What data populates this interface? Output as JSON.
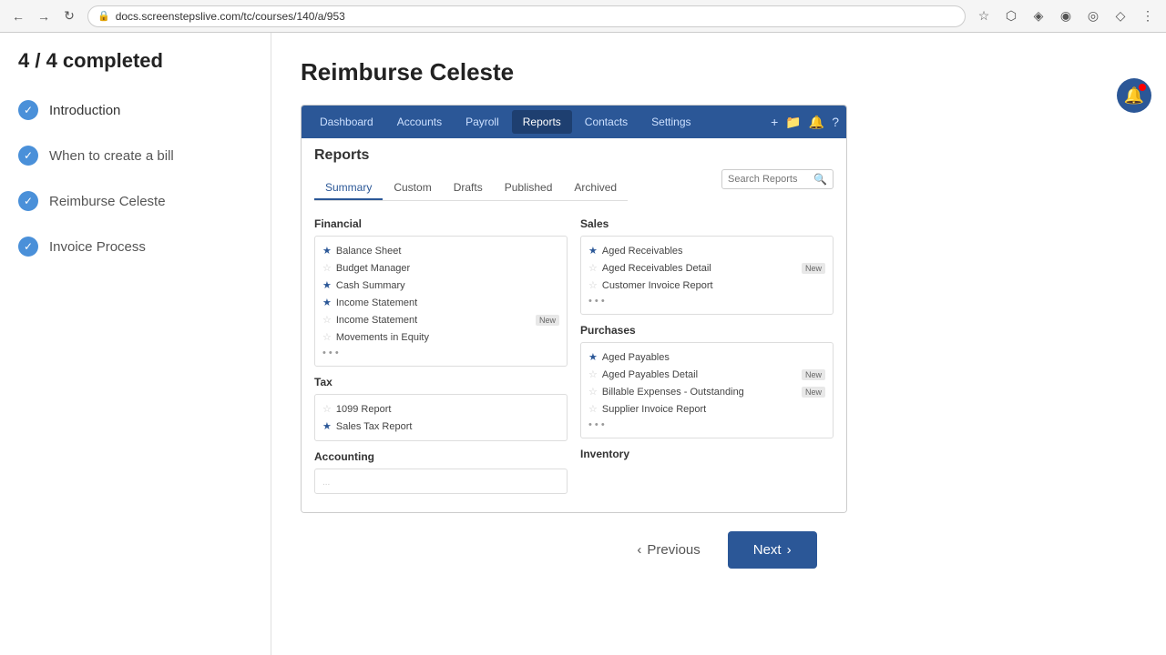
{
  "browser": {
    "url": "docs.screenstepslive.com/tc/courses/140/a/953",
    "back_title": "Back",
    "forward_title": "Forward",
    "refresh_title": "Refresh"
  },
  "progress": {
    "label": "4 / 4 completed"
  },
  "sidebar": {
    "items": [
      {
        "id": "introduction",
        "label": "Introduction",
        "completed": true
      },
      {
        "id": "when-to-create-a-bill",
        "label": "When to create a bill",
        "completed": true
      },
      {
        "id": "reimburse-celeste",
        "label": "Reimburse Celeste",
        "completed": true
      },
      {
        "id": "invoice-process",
        "label": "Invoice Process",
        "completed": true
      }
    ]
  },
  "main": {
    "title": "Reimburse Celeste",
    "app": {
      "nav_items": [
        {
          "label": "Dashboard",
          "active": false
        },
        {
          "label": "Accounts",
          "active": false
        },
        {
          "label": "Payroll",
          "active": false
        },
        {
          "label": "Reports",
          "active": true
        },
        {
          "label": "Contacts",
          "active": false
        },
        {
          "label": "Settings",
          "active": false
        }
      ],
      "reports_title": "Reports",
      "tabs": [
        {
          "label": "Summary",
          "active": true
        },
        {
          "label": "Custom",
          "active": false
        },
        {
          "label": "Drafts",
          "active": false
        },
        {
          "label": "Published",
          "active": false
        },
        {
          "label": "Archived",
          "active": false
        }
      ],
      "search_placeholder": "Search Reports",
      "financial": {
        "title": "Financial",
        "items": [
          {
            "label": "Balance Sheet",
            "starred": true
          },
          {
            "label": "Budget Manager",
            "starred": false
          },
          {
            "label": "Cash Summary",
            "starred": true
          },
          {
            "label": "Income Statement",
            "starred": true
          },
          {
            "label": "Income Statement",
            "starred": false,
            "badge": "New"
          },
          {
            "label": "Movements in Equity",
            "starred": false
          }
        ]
      },
      "tax": {
        "title": "Tax",
        "items": [
          {
            "label": "1099 Report",
            "starred": false
          },
          {
            "label": "Sales Tax Report",
            "starred": true
          }
        ]
      },
      "accounting": {
        "title": "Accounting"
      },
      "sales": {
        "title": "Sales",
        "items": [
          {
            "label": "Aged Receivables",
            "starred": true
          },
          {
            "label": "Aged Receivables Detail",
            "starred": false,
            "badge": "New"
          },
          {
            "label": "Customer Invoice Report",
            "starred": false
          }
        ]
      },
      "purchases": {
        "title": "Purchases",
        "items": [
          {
            "label": "Aged Payables",
            "starred": true
          },
          {
            "label": "Aged Payables Detail",
            "starred": false,
            "badge": "New"
          },
          {
            "label": "Billable Expenses - Outstanding",
            "starred": false,
            "badge": "New"
          },
          {
            "label": "Supplier Invoice Report",
            "starred": false
          }
        ]
      },
      "inventory": {
        "title": "Inventory"
      }
    }
  },
  "buttons": {
    "previous": "Previous",
    "next": "Next"
  }
}
